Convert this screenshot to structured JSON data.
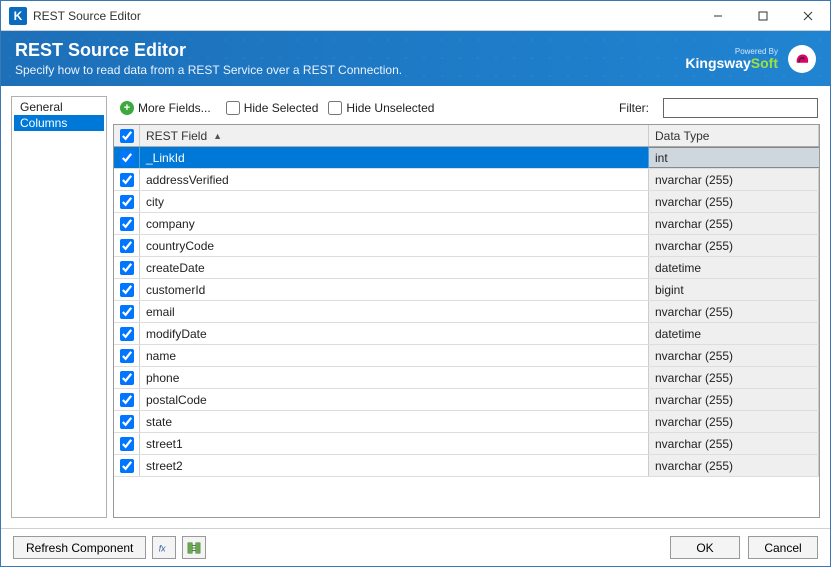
{
  "window": {
    "title": "REST Source Editor"
  },
  "banner": {
    "heading": "REST Source Editor",
    "subtitle": "Specify how to read data from a REST Service over a REST Connection.",
    "powered_by": "Powered By",
    "brand_a": "Kingsway",
    "brand_b": "Soft"
  },
  "sidebar": {
    "items": [
      {
        "label": "General",
        "selected": false
      },
      {
        "label": "Columns",
        "selected": true
      }
    ]
  },
  "toolbar": {
    "more_fields": "More Fields...",
    "hide_selected": "Hide Selected",
    "hide_unselected": "Hide Unselected",
    "filter_label": "Filter:",
    "filter_value": ""
  },
  "grid": {
    "header_field": "REST Field",
    "header_type": "Data Type",
    "rows": [
      {
        "checked": true,
        "field": "_LinkId",
        "type": "int",
        "selected": true
      },
      {
        "checked": true,
        "field": "addressVerified",
        "type": "nvarchar (255)",
        "selected": false
      },
      {
        "checked": true,
        "field": "city",
        "type": "nvarchar (255)",
        "selected": false
      },
      {
        "checked": true,
        "field": "company",
        "type": "nvarchar (255)",
        "selected": false
      },
      {
        "checked": true,
        "field": "countryCode",
        "type": "nvarchar (255)",
        "selected": false
      },
      {
        "checked": true,
        "field": "createDate",
        "type": "datetime",
        "selected": false
      },
      {
        "checked": true,
        "field": "customerId",
        "type": "bigint",
        "selected": false
      },
      {
        "checked": true,
        "field": "email",
        "type": "nvarchar (255)",
        "selected": false
      },
      {
        "checked": true,
        "field": "modifyDate",
        "type": "datetime",
        "selected": false
      },
      {
        "checked": true,
        "field": "name",
        "type": "nvarchar (255)",
        "selected": false
      },
      {
        "checked": true,
        "field": "phone",
        "type": "nvarchar (255)",
        "selected": false
      },
      {
        "checked": true,
        "field": "postalCode",
        "type": "nvarchar (255)",
        "selected": false
      },
      {
        "checked": true,
        "field": "state",
        "type": "nvarchar (255)",
        "selected": false
      },
      {
        "checked": true,
        "field": "street1",
        "type": "nvarchar (255)",
        "selected": false
      },
      {
        "checked": true,
        "field": "street2",
        "type": "nvarchar (255)",
        "selected": false
      }
    ]
  },
  "footer": {
    "refresh": "Refresh Component",
    "ok": "OK",
    "cancel": "Cancel"
  }
}
